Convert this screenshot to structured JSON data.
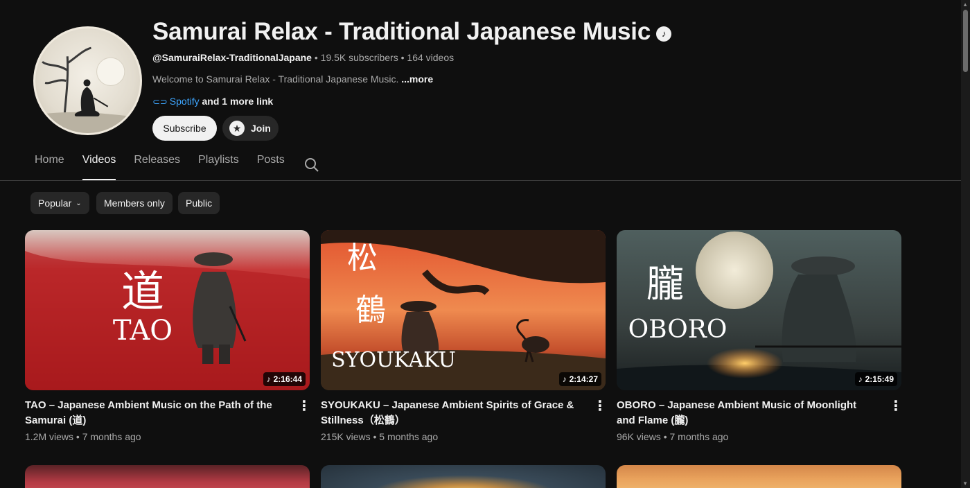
{
  "channel": {
    "name": "Samurai Relax - Traditional Japanese Music",
    "verified_icon": "music-note-verified-icon",
    "handle": "@SamuraiRelax-TraditionalJapane",
    "subscribers": "19.5K subscribers",
    "videos": "164 videos",
    "separator": "•",
    "description": "Welcome to Samurai Relax - Traditional Japanese Music.",
    "more_label": "...more",
    "link_label": "Spotify",
    "more_links": "and 1 more link",
    "subscribe_label": "Subscribe",
    "join_label": "Join"
  },
  "tabs": [
    {
      "label": "Home",
      "active": false
    },
    {
      "label": "Videos",
      "active": true
    },
    {
      "label": "Releases",
      "active": false
    },
    {
      "label": "Playlists",
      "active": false
    },
    {
      "label": "Posts",
      "active": false
    }
  ],
  "chips": [
    {
      "label": "Popular",
      "selected": true
    },
    {
      "label": "Members only",
      "selected": false
    },
    {
      "label": "Public",
      "selected": false
    }
  ],
  "videos": [
    {
      "thumb_text_jp": "道",
      "thumb_text_en": "TAO",
      "duration": "2:16:44",
      "title": "TAO – Japanese Ambient Music on the Path of the Samurai (道)",
      "views": "1.2M views",
      "age": "7 months ago"
    },
    {
      "thumb_text_jp": "松\n鶴",
      "thumb_text_jp_1": "松",
      "thumb_text_jp_2": "鶴",
      "thumb_text_en": "SYOUKAKU",
      "duration": "2:14:27",
      "title": "SYOUKAKU – Japanese Ambient Spirits of Grace & Stillness（松鶴）",
      "views": "215K views",
      "age": "5 months ago"
    },
    {
      "thumb_text_jp": "朧",
      "thumb_text_en": "OBORO",
      "duration": "2:15:49",
      "title": "OBORO – Japanese Ambient Music of Moonlight and Flame (朧)",
      "views": "96K views",
      "age": "7 months ago"
    }
  ],
  "colors": {
    "background": "#0f0f0f",
    "text": "#f1f1f1",
    "secondary_text": "#aaaaaa",
    "link": "#3ea6ff",
    "chip": "#272727"
  }
}
